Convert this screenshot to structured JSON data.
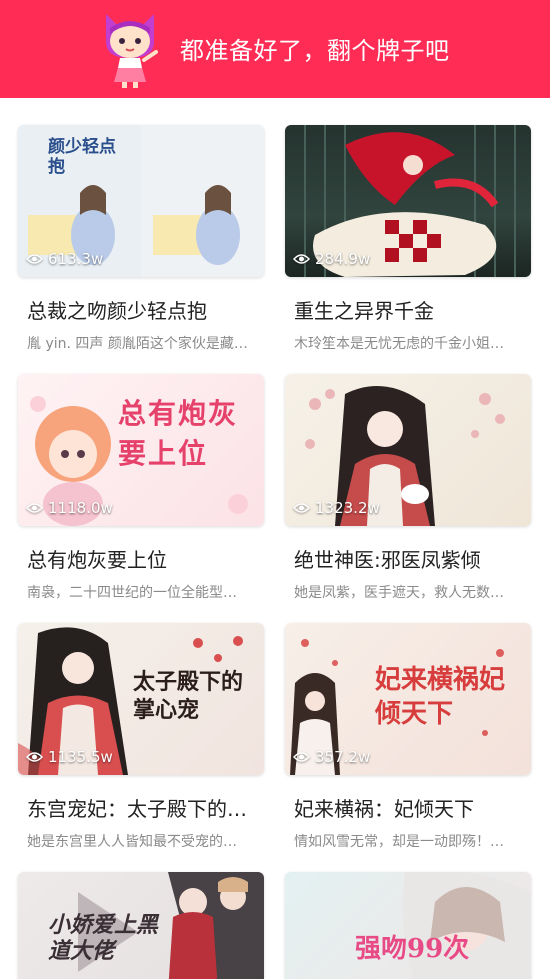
{
  "header": {
    "title": "都准备好了，翻个牌子吧",
    "mascot_icon": "cat-mascot-icon",
    "background": "#ff2d55"
  },
  "books": [
    {
      "title": "总裁之吻颜少轻点抱",
      "description": "胤 yin. 四声 颜胤陌这个家伙是藏…",
      "views": "613.3w",
      "cover_text": "颜少轻点抱",
      "cover_colors": [
        "#e8eef2",
        "#f4d9c4",
        "#b8c7e6"
      ]
    },
    {
      "title": "重生之异界千金",
      "description": "木玲笙本是无忧无虑的千金小姐…",
      "views": "284.9w",
      "cover_text": "",
      "cover_colors": [
        "#2b3a35",
        "#c8172a",
        "#f2ecdf"
      ]
    },
    {
      "title": "总有炮灰要上位",
      "description": "南袅，二十四世纪的一位全能型…",
      "views": "1118.0w",
      "cover_text": "总有炮灰要上位",
      "cover_colors": [
        "#fbeef0",
        "#f7a9a2",
        "#e5416b"
      ]
    },
    {
      "title": "绝世神医:邪医凤紫倾",
      "description": "她是凤紫，医手遮天，救人无数…",
      "views": "1323.2w",
      "cover_text": "",
      "cover_colors": [
        "#f3ede2",
        "#e9b7b5",
        "#c64b4b"
      ]
    },
    {
      "title": "东宫宠妃：太子殿下的…",
      "description": "她是东宫里人人皆知最不受宠的…",
      "views": "1135.5w",
      "cover_text": "太子殿下的掌心宠",
      "cover_colors": [
        "#f4efe9",
        "#d94f4f",
        "#26211f"
      ]
    },
    {
      "title": "妃来横祸：妃倾天下",
      "description": "情如风雪无常，却是一动即殇！…",
      "views": "357.2w",
      "cover_text": "妃来横祸妃倾天下",
      "cover_colors": [
        "#f6ece5",
        "#d73d3d",
        "#8a6b5a"
      ]
    },
    {
      "title": "",
      "description": "",
      "views": "",
      "cover_text": "小娇爱上黑道大佬",
      "cover_colors": [
        "#ece8e8",
        "#3a2f35",
        "#d8b08a"
      ]
    },
    {
      "title": "",
      "description": "",
      "views": "",
      "cover_text": "强吻99次",
      "cover_colors": [
        "#dfeef0",
        "#f0d2cf",
        "#e84a86"
      ]
    }
  ],
  "icons": {
    "views": "eye-icon"
  }
}
